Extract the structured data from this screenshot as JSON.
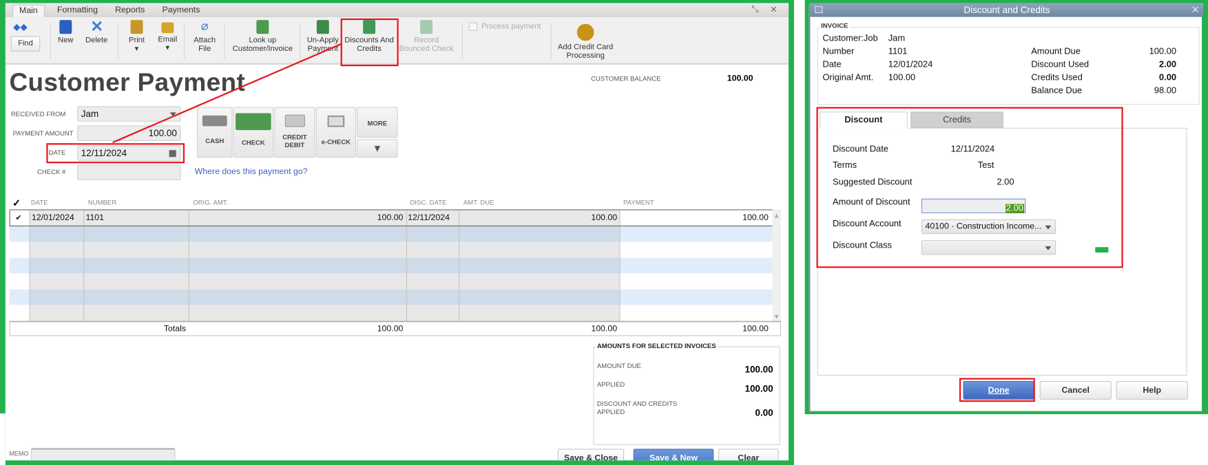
{
  "main_window": {
    "tabs": [
      "Main",
      "Formatting",
      "Reports",
      "Payments"
    ],
    "toolbar": {
      "find": "Find",
      "new": "New",
      "delete": "Delete",
      "print": "Print",
      "email": "Email",
      "attach_1": "Attach",
      "attach_2": "File",
      "lookup_1": "Look up",
      "lookup_2": "Customer/Invoice",
      "unapply_1": "Un-Apply",
      "unapply_2": "Payment",
      "discounts_1": "Discounts And",
      "discounts_2": "Credits",
      "bounced_1": "Record",
      "bounced_2": "Bounced Check",
      "process_payment": "Process payment",
      "addcc_1": "Add Credit Card",
      "addcc_2": "Processing"
    },
    "title": "Customer Payment",
    "customer_balance_label": "CUSTOMER BALANCE",
    "customer_balance": "100.00",
    "form": {
      "received_from_label": "RECEIVED FROM",
      "received_from": "Jam",
      "payment_amount_label": "PAYMENT AMOUNT",
      "payment_amount": "100.00",
      "date_label": "DATE",
      "date": "12/11/2024",
      "check_label": "CHECK #",
      "check": ""
    },
    "methods": {
      "cash": "CASH",
      "check": "CHECK",
      "credit_1": "CREDIT",
      "credit_2": "DEBIT",
      "echeck": "e-CHECK",
      "more": "MORE"
    },
    "link": "Where does this payment go?",
    "table": {
      "headers": [
        "DATE",
        "NUMBER",
        "ORIG. AMT.",
        "DISC. DATE",
        "AMT. DUE",
        "PAYMENT"
      ],
      "rows": [
        {
          "checked": "✔",
          "date": "12/01/2024",
          "number": "1101",
          "orig": "100.00",
          "disc_date": "12/11/2024",
          "amt_due": "100.00",
          "payment": "100.00"
        }
      ],
      "totals_label": "Totals",
      "totals": {
        "orig": "100.00",
        "amt_due": "100.00",
        "payment": "100.00"
      }
    },
    "amounts": {
      "title": "AMOUNTS FOR SELECTED INVOICES",
      "amount_due_label": "AMOUNT DUE",
      "amount_due": "100.00",
      "applied_label": "APPLIED",
      "applied": "100.00",
      "disc_label_1": "DISCOUNT AND CREDITS",
      "disc_label_2": "APPLIED",
      "disc": "0.00"
    },
    "memo_label": "MEMO",
    "buttons": {
      "save_close": "Save & Close",
      "save_new": "Save & New",
      "clear": "Clear"
    }
  },
  "dialog": {
    "title": "Discount and Credits",
    "invoice": {
      "group": "INVOICE",
      "customer_label": "Customer:Job",
      "customer": "Jam",
      "number_label": "Number",
      "number": "1101",
      "date_label": "Date",
      "date": "12/01/2024",
      "orig_label": "Original Amt.",
      "orig": "100.00",
      "amount_due_label": "Amount Due",
      "amount_due": "100.00",
      "discount_used_label": "Discount Used",
      "discount_used": "2.00",
      "credits_used_label": "Credits Used",
      "credits_used": "0.00",
      "balance_due_label": "Balance Due",
      "balance_due": "98.00"
    },
    "tabs": [
      "Discount",
      "Credits"
    ],
    "discount": {
      "date_label": "Discount Date",
      "date": "12/11/2024",
      "terms_label": "Terms",
      "terms": "Test",
      "suggested_label": "Suggested Discount",
      "suggested": "2.00",
      "amount_label": "Amount of Discount",
      "amount": "2.00",
      "account_label": "Discount Account",
      "account": "40100 · Construction Income...",
      "class_label": "Discount Class",
      "class": ""
    },
    "buttons": {
      "done": "Done",
      "cancel": "Cancel",
      "help": "Help"
    }
  }
}
